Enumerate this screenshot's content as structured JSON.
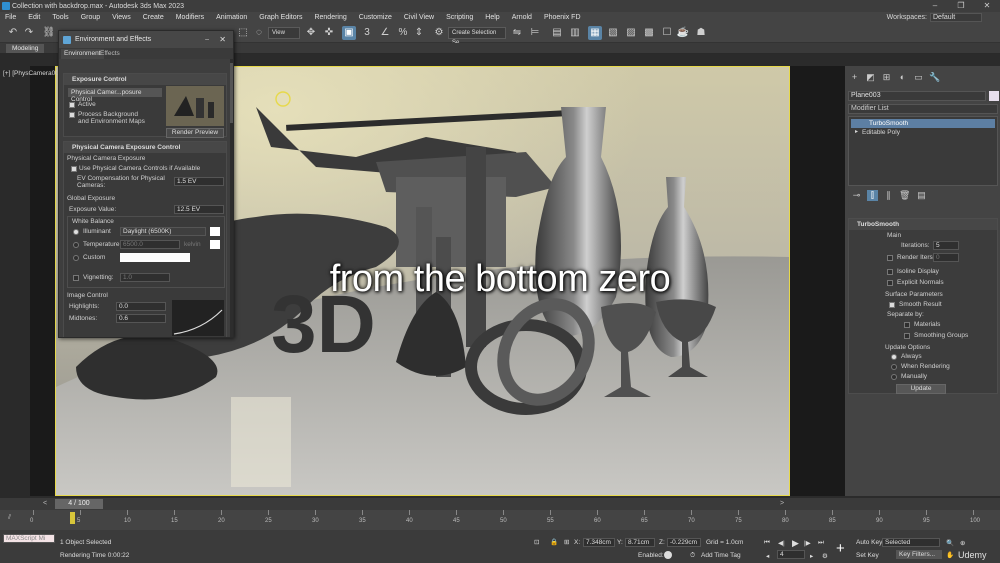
{
  "window": {
    "title": "Collection with backdrop.max - Autodesk 3ds Max 2023",
    "min": "–",
    "max": "❐",
    "close": "✕"
  },
  "menu": [
    "File",
    "Edit",
    "Tools",
    "Group",
    "Views",
    "Create",
    "Modifiers",
    "Animation",
    "Graph Editors",
    "Rendering",
    "Customize",
    "Civil View",
    "Scripting",
    "Help",
    "Arnold",
    "Phoenix FD"
  ],
  "workspaces": {
    "label": "Workspaces:",
    "value": "Default"
  },
  "toolbar": {
    "view_select": "View",
    "selection_set": "Create Selection Se"
  },
  "ribbon": {
    "tabs": [
      "Modeling"
    ]
  },
  "viewport": {
    "label": "[+] [PhysCamera00"
  },
  "subtitle": "from the bottom zero",
  "env": {
    "title": "Environment and Effects",
    "tabs": [
      "Environment",
      "Effects"
    ],
    "exposure_control": {
      "heading": "Exposure Control",
      "dropdown": "Physical Camer...posure Control",
      "active": "Active",
      "process_bg": "Process Background and Environment Maps",
      "render_preview": "Render Preview"
    },
    "physcam": {
      "heading": "Physical Camera Exposure Control",
      "section": "Physical Camera Exposure",
      "use_controls": "Use Physical Camera Controls if Available",
      "ev_comp_label": "EV Compensation for Physical Cameras:",
      "ev_comp_value": "1.5 EV",
      "global_exposure": "Global Exposure",
      "exposure_value_label": "Exposure Value:",
      "exposure_value": "12.5 EV",
      "white_balance": "White Balance",
      "illuminant": "Illuminant",
      "illuminant_value": "Daylight (6500K)",
      "temperature": "Temperature",
      "temperature_value": "6500.0",
      "kelvin": "kelvin",
      "custom": "Custom",
      "vignetting": "Vignetting:",
      "vignetting_value": "1.0",
      "image_control": "Image Control",
      "highlights": "Highlights:",
      "highlights_value": "0.0",
      "midtones": "Midtones:",
      "midtones_value": "0.6"
    }
  },
  "cmdpanel": {
    "object_name": "Plane003",
    "object_color": "#e8e0ee",
    "modifier_list": "Modifier List",
    "stack": [
      "TurboSmooth",
      "Editable Poly"
    ],
    "turbosmooth": {
      "heading": "TurboSmooth",
      "main": "Main",
      "iterations_label": "Iterations:",
      "iterations": "5",
      "render_iters_label": "Render Iters:",
      "render_iters": "0",
      "isoline": "Isoline Display",
      "explicit_normals": "Explicit Normals",
      "surface_params": "Surface Parameters",
      "smooth_result": "Smooth Result",
      "separate_by": "Separate by:",
      "materials": "Materials",
      "smoothing_groups": "Smoothing Groups",
      "update_options": "Update Options",
      "always": "Always",
      "when_rendering": "When Rendering",
      "manually": "Manually",
      "update_btn": "Update"
    }
  },
  "timeline": {
    "frame": "4 / 100",
    "ticks": [
      "0",
      "5",
      "10",
      "15",
      "20",
      "25",
      "30",
      "35",
      "40",
      "45",
      "50",
      "55",
      "60",
      "65",
      "70",
      "75",
      "80",
      "85",
      "90",
      "95",
      "100"
    ]
  },
  "status": {
    "maxscript": "MAXScript Mi",
    "selected": "1 Object Selected",
    "render_time": "Rendering Time 0:00:22",
    "x_label": "X:",
    "x_value": "7.348cm",
    "y_label": "Y:",
    "y_value": "8.71cm",
    "z_label": "Z:",
    "z_value": "-0.229cm",
    "grid": "Grid = 1.0cm",
    "enabled": "Enabled:",
    "add_time_tag": "Add Time Tag",
    "auto_key": "Auto Key",
    "set_key": "Set Key",
    "selected_dd": "Selected",
    "key_filters": "Key Filters...",
    "frame_num": "4",
    "watermark": "Udemy"
  },
  "colors": {
    "viewport_border": "#e7d94a",
    "selection_blue": "#5d7fa3",
    "accent": "#2f8fd0"
  }
}
